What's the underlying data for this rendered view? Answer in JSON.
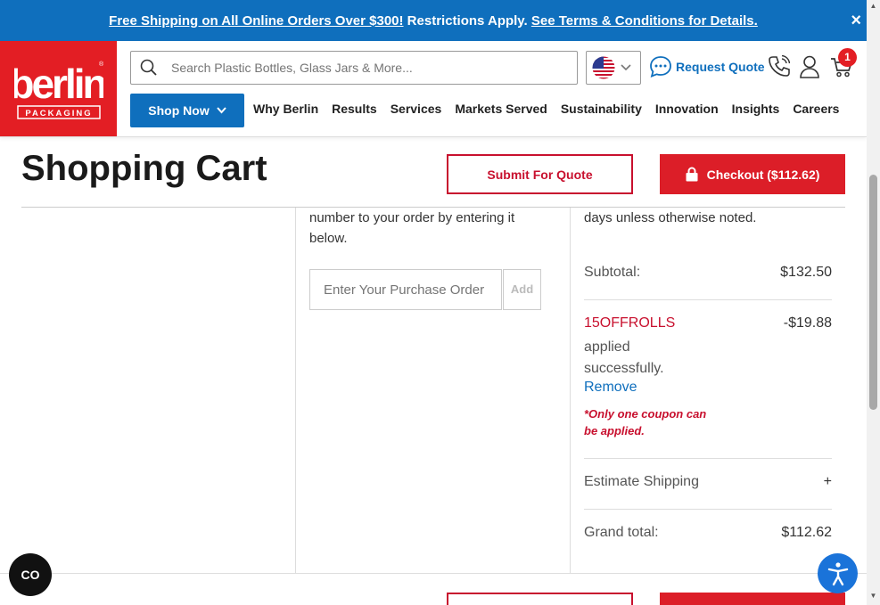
{
  "banner": {
    "part1": "Free Shipping on All Online Orders Over $300!",
    "part2": " Restrictions Apply. ",
    "part3": "See Terms & Conditions for Details.",
    "close": "×"
  },
  "header": {
    "logo_text": "berlin",
    "logo_sub": "PACKAGING",
    "search_placeholder": "Search Plastic Bottles, Glass Jars & More...",
    "request_quote": "Request Quote",
    "cart_count": "1",
    "shop_now": "Shop Now",
    "nav": [
      "Why Berlin",
      "Results",
      "Services",
      "Markets Served",
      "Sustainability",
      "Innovation",
      "Insights",
      "Careers"
    ]
  },
  "cart": {
    "title": "Shopping Cart",
    "submit_quote": "Submit For Quote",
    "checkout": "Checkout ($112.62)"
  },
  "po": {
    "text": "number to your order by entering it below.",
    "placeholder": "Enter Your Purchase Order",
    "add": "Add"
  },
  "summary": {
    "delivery_text": "days unless otherwise noted.",
    "subtotal_label": "Subtotal:",
    "subtotal_value": "$132.50",
    "coupon_code": "15OFFROLLS",
    "coupon_amount": "-$19.88",
    "coupon_msg": "applied successfully.",
    "remove": "Remove",
    "coupon_note": "*Only one coupon can be applied.",
    "estimate_shipping": "Estimate Shipping",
    "estimate_toggle": "+",
    "grand_total_label": "Grand total:",
    "grand_total_value": "$112.62"
  },
  "widgets": {
    "co_label": "CO"
  },
  "colors": {
    "brand_red": "#e31e24",
    "brand_blue": "#0f6fbd"
  }
}
